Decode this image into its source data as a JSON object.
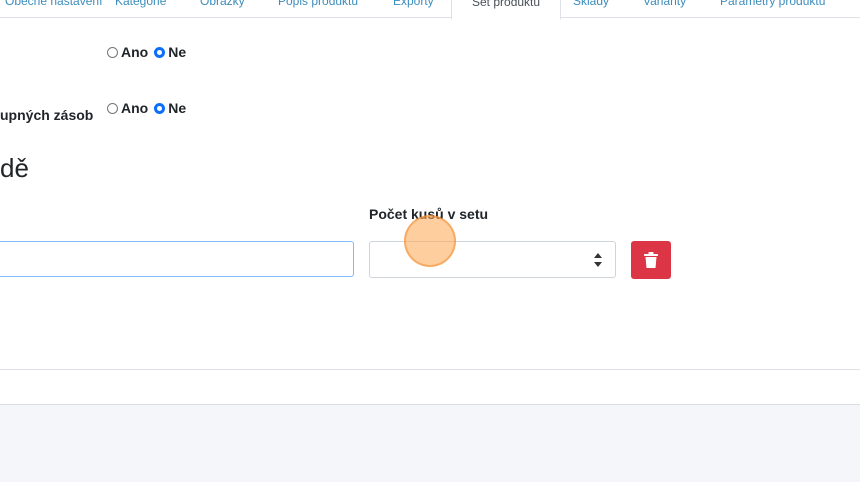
{
  "tabs": [
    {
      "label": "Obecné nastavení"
    },
    {
      "label": "Kategorie"
    },
    {
      "label": "Obrázky"
    },
    {
      "label": "Popis produktu"
    },
    {
      "label": "Exporty"
    },
    {
      "label": "Set produktu"
    },
    {
      "label": "Sklady"
    },
    {
      "label": "Varianty"
    },
    {
      "label": "Parametry produktu"
    }
  ],
  "options": {
    "row1": {
      "yes": "Ano",
      "no": "Ne",
      "selected": "Ne"
    },
    "row2": {
      "label": "upných zásob",
      "yes": "Ano",
      "no": "Ne",
      "selected": "Ne"
    }
  },
  "section": {
    "heading": "dě"
  },
  "set_item": {
    "product_value": "",
    "quantity_label": "Počet kusů v setu",
    "quantity_value": ""
  },
  "colors": {
    "accent": "#3c8dbc",
    "radio_checked": "#0d6efd",
    "delete": "#dc3545",
    "footer_bg": "#f4f6f9"
  },
  "icons": {
    "delete": "trash-icon"
  }
}
